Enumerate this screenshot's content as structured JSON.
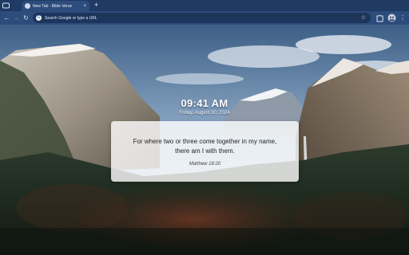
{
  "browser": {
    "tab": {
      "title": "New Tab - Bible Verse",
      "close_glyph": "×"
    },
    "new_tab_glyph": "+",
    "nav": {
      "back_glyph": "←",
      "forward_glyph": "→",
      "reload_glyph": "↻"
    },
    "omnibox": {
      "google_glyph": "G",
      "placeholder": "Search Google or type a URL",
      "star_glyph": "☆"
    },
    "menu_glyph": "⋮"
  },
  "clock": {
    "time": "09:41 AM",
    "date": "Friday, August 30, 2024"
  },
  "verse": {
    "text_line1": "For where two or three come together in my name,",
    "text_line2": "there am I with them.",
    "reference": "Matthew 18:20"
  },
  "colors": {
    "tabstrip": "#1f3a63",
    "toolbar": "#2c4c7c",
    "omnibox": "#1d355b",
    "card": "#ffffff"
  }
}
